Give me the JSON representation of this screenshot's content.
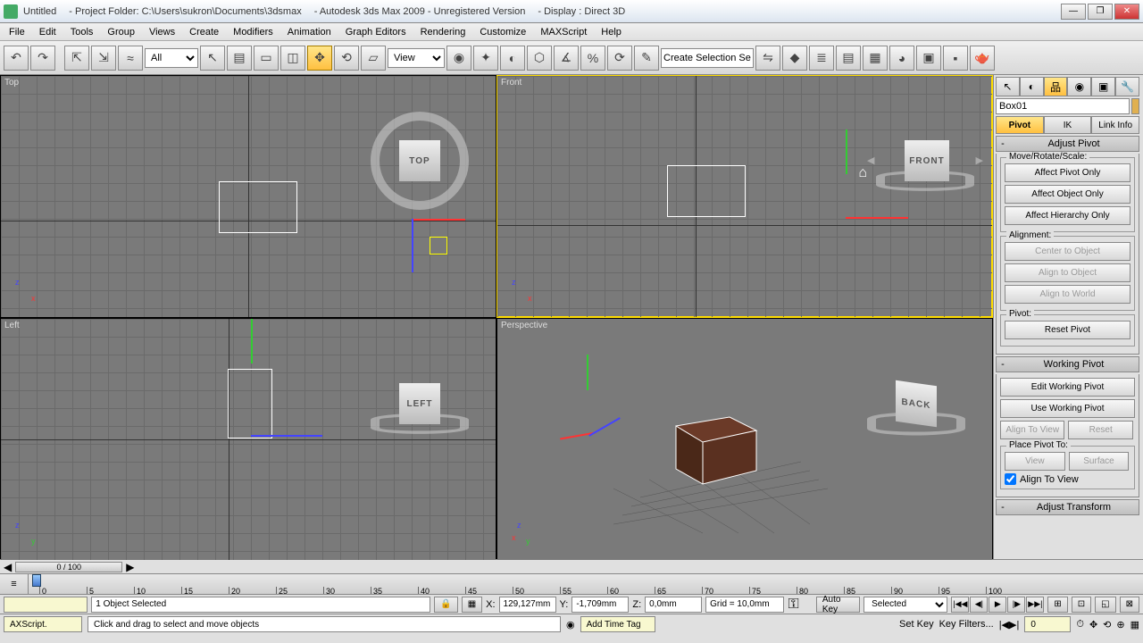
{
  "title": {
    "doc": "Untitled",
    "folder": "- Project Folder: C:\\Users\\sukron\\Documents\\3dsmax",
    "app": "- Autodesk 3ds Max 2009 - Unregistered Version",
    "display": "- Display : Direct 3D"
  },
  "menu": [
    "File",
    "Edit",
    "Tools",
    "Group",
    "Views",
    "Create",
    "Modifiers",
    "Animation",
    "Graph Editors",
    "Rendering",
    "Customize",
    "MAXScript",
    "Help"
  ],
  "toolbar": {
    "filter": "All",
    "refsys": "View",
    "selset": "Create Selection Set",
    "icons": [
      "↶",
      "↷",
      "⬚",
      "⬚",
      "⬚",
      "▦",
      "⬚",
      "⬚",
      "⬚",
      "⬚",
      "✥",
      "⟲",
      "▭",
      "⬚",
      "⬚",
      "⬚",
      "⬚",
      "⬚"
    ]
  },
  "viewports": {
    "top": "Top",
    "front": "Front",
    "left": "Left",
    "persp": "Perspective",
    "cubes": {
      "top": "TOP",
      "front": "FRONT",
      "left": "LEFT",
      "back": "BACK"
    }
  },
  "panel": {
    "objname": "Box01",
    "modes": {
      "pivot": "Pivot",
      "ik": "IK",
      "link": "Link Info"
    },
    "adjust_pivot": "Adjust Pivot",
    "mrs": "Move/Rotate/Scale:",
    "affect_pivot": "Affect Pivot Only",
    "affect_object": "Affect Object Only",
    "affect_hier": "Affect Hierarchy Only",
    "alignment": "Alignment:",
    "center_obj": "Center to Object",
    "align_obj": "Align to Object",
    "align_world": "Align to World",
    "pivot_g": "Pivot:",
    "reset_pivot": "Reset Pivot",
    "working_pivot": "Working Pivot",
    "edit_wp": "Edit Working Pivot",
    "use_wp": "Use Working Pivot",
    "align_view": "Align To View",
    "reset": "Reset",
    "place_pivot": "Place Pivot To:",
    "view": "View",
    "surface": "Surface",
    "align_view_chk": "Align To View",
    "adjust_transform": "Adjust Transform"
  },
  "time": {
    "frames": "0 / 100",
    "ruler_ticks": [
      0,
      5,
      10,
      15,
      20,
      25,
      30,
      35,
      40,
      45,
      50,
      55,
      60,
      65,
      70,
      75,
      80,
      85,
      90,
      95,
      100
    ]
  },
  "status": {
    "sel": "1 Object Selected",
    "x_lbl": "X:",
    "x": "129,127mm",
    "y_lbl": "Y:",
    "y": "-1,709mm",
    "z_lbl": "Z:",
    "z": "0,0mm",
    "grid": "Grid = 10,0mm",
    "autokey": "Auto Key",
    "setkey": "Set Key",
    "selected": "Selected",
    "keyfilters": "Key Filters...",
    "frame": "0",
    "axscript": "AXScript.",
    "prompt": "Click and drag to select and move objects",
    "addtag": "Add Time Tag"
  }
}
